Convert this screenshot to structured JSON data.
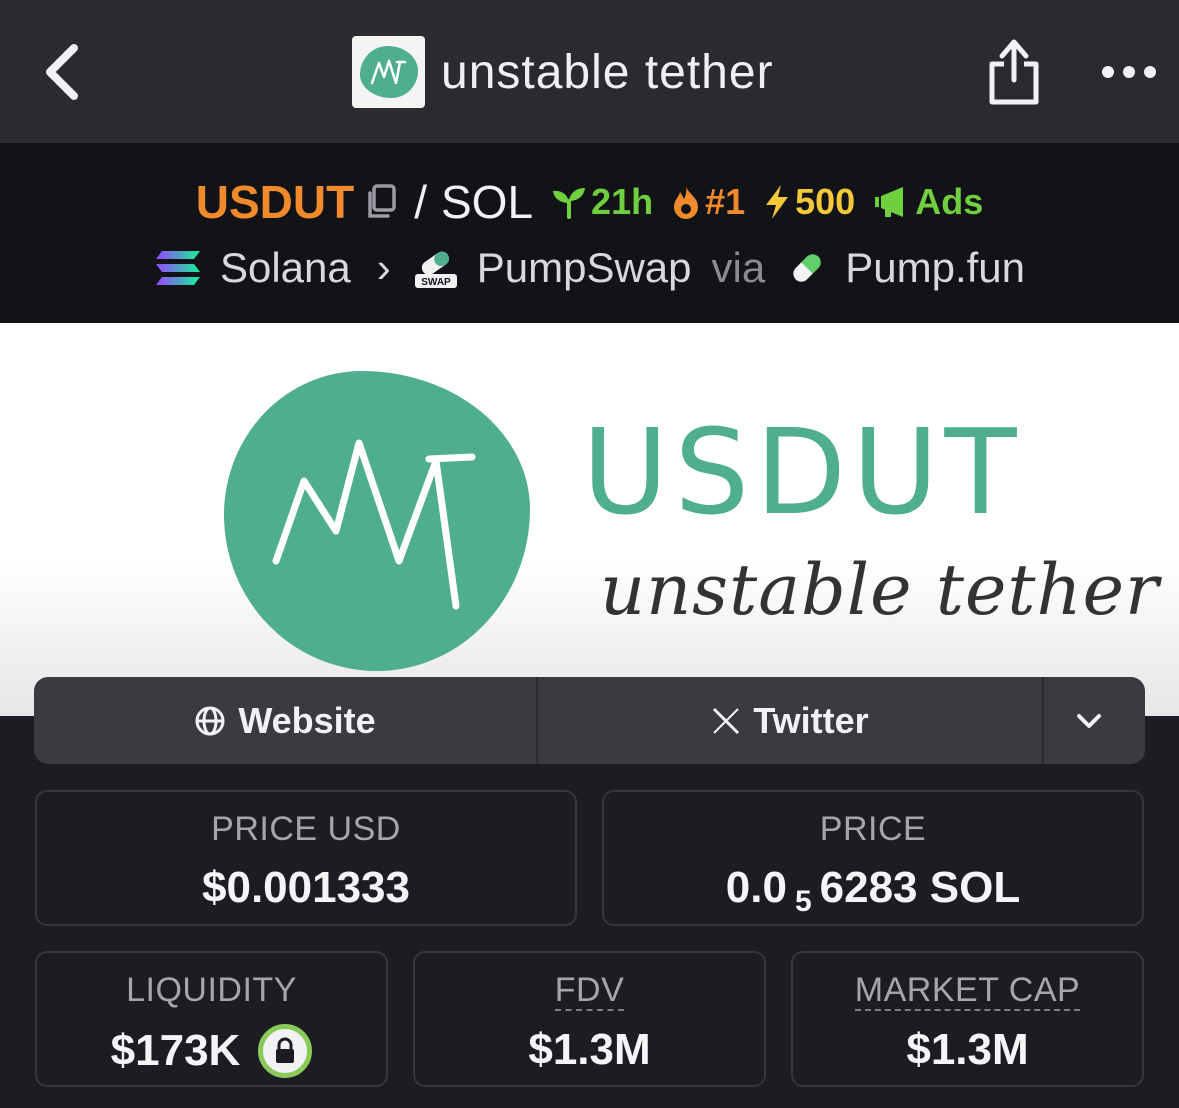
{
  "header": {
    "title": "unstable tether",
    "logo_text": "MWT"
  },
  "pair": {
    "base": "USDUT",
    "separator": "/",
    "quote": "SOL",
    "age": "21h",
    "rank": "#1",
    "boosts": "500",
    "ads": "Ads"
  },
  "chain": {
    "network": "Solana",
    "dex": "PumpSwap",
    "via": "via",
    "launchpad": "Pump.fun",
    "swap_badge": "SWAP"
  },
  "banner": {
    "wordmark": "USDUT",
    "tagline": "unstable tether"
  },
  "links": {
    "website": "Website",
    "twitter": "Twitter"
  },
  "stats": {
    "price_usd_label": "PRICE USD",
    "price_usd": "$0.001333",
    "price_label": "PRICE",
    "price_prefix": "0.0",
    "price_zeros": "5",
    "price_suffix": "6283 SOL",
    "liquidity_label": "LIQUIDITY",
    "liquidity": "$173K",
    "fdv_label": "FDV",
    "fdv": "$1.3M",
    "mcap_label": "MARKET CAP",
    "mcap": "$1.3M"
  },
  "colors": {
    "accent_orange": "#f08a2a",
    "accent_green": "#6fcf3f",
    "accent_yellow": "#f3c93a",
    "brand_teal": "#4fae8f"
  },
  "icons": [
    "back-chevron-icon",
    "share-icon",
    "more-icon",
    "copy-icon",
    "seedling-icon",
    "fire-icon",
    "bolt-icon",
    "megaphone-icon",
    "solana-icon",
    "pumpswap-icon",
    "pill-icon",
    "globe-icon",
    "x-icon",
    "chevron-down-icon",
    "lock-icon"
  ]
}
